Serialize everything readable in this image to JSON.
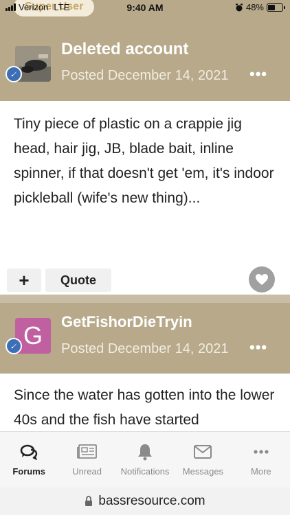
{
  "status_bar": {
    "carrier": "Verizon",
    "network": "LTE",
    "time": "9:40 AM",
    "battery": "48%",
    "battery_level": 0.48
  },
  "posts": [
    {
      "badge": "Super User",
      "author": "Deleted account",
      "posted": "Posted December 14, 2021",
      "more": "•••",
      "content": "Tiny piece of plastic on a crappie jig head, hair jig, JB, blade bait, inline spinner, if that doesn't get 'em, it's indoor pickleball (wife's new thing)...",
      "plus_label": "+",
      "quote_label": "Quote"
    },
    {
      "avatar_letter": "G",
      "author": "GetFishorDieTryin",
      "posted": "Posted December 14, 2021",
      "more": "•••",
      "content": "Since the water has gotten into the lower 40s and the fish have started"
    }
  ],
  "bottom_nav": [
    {
      "label": "Forums",
      "icon": "forums-icon",
      "active": true
    },
    {
      "label": "Unread",
      "icon": "unread-icon",
      "active": false
    },
    {
      "label": "Notifications",
      "icon": "bell-icon",
      "active": false
    },
    {
      "label": "Messages",
      "icon": "envelope-icon",
      "active": false
    },
    {
      "label": "More",
      "icon": "more-icon",
      "active": false
    }
  ],
  "url_bar": {
    "url": "bassresource.com"
  }
}
